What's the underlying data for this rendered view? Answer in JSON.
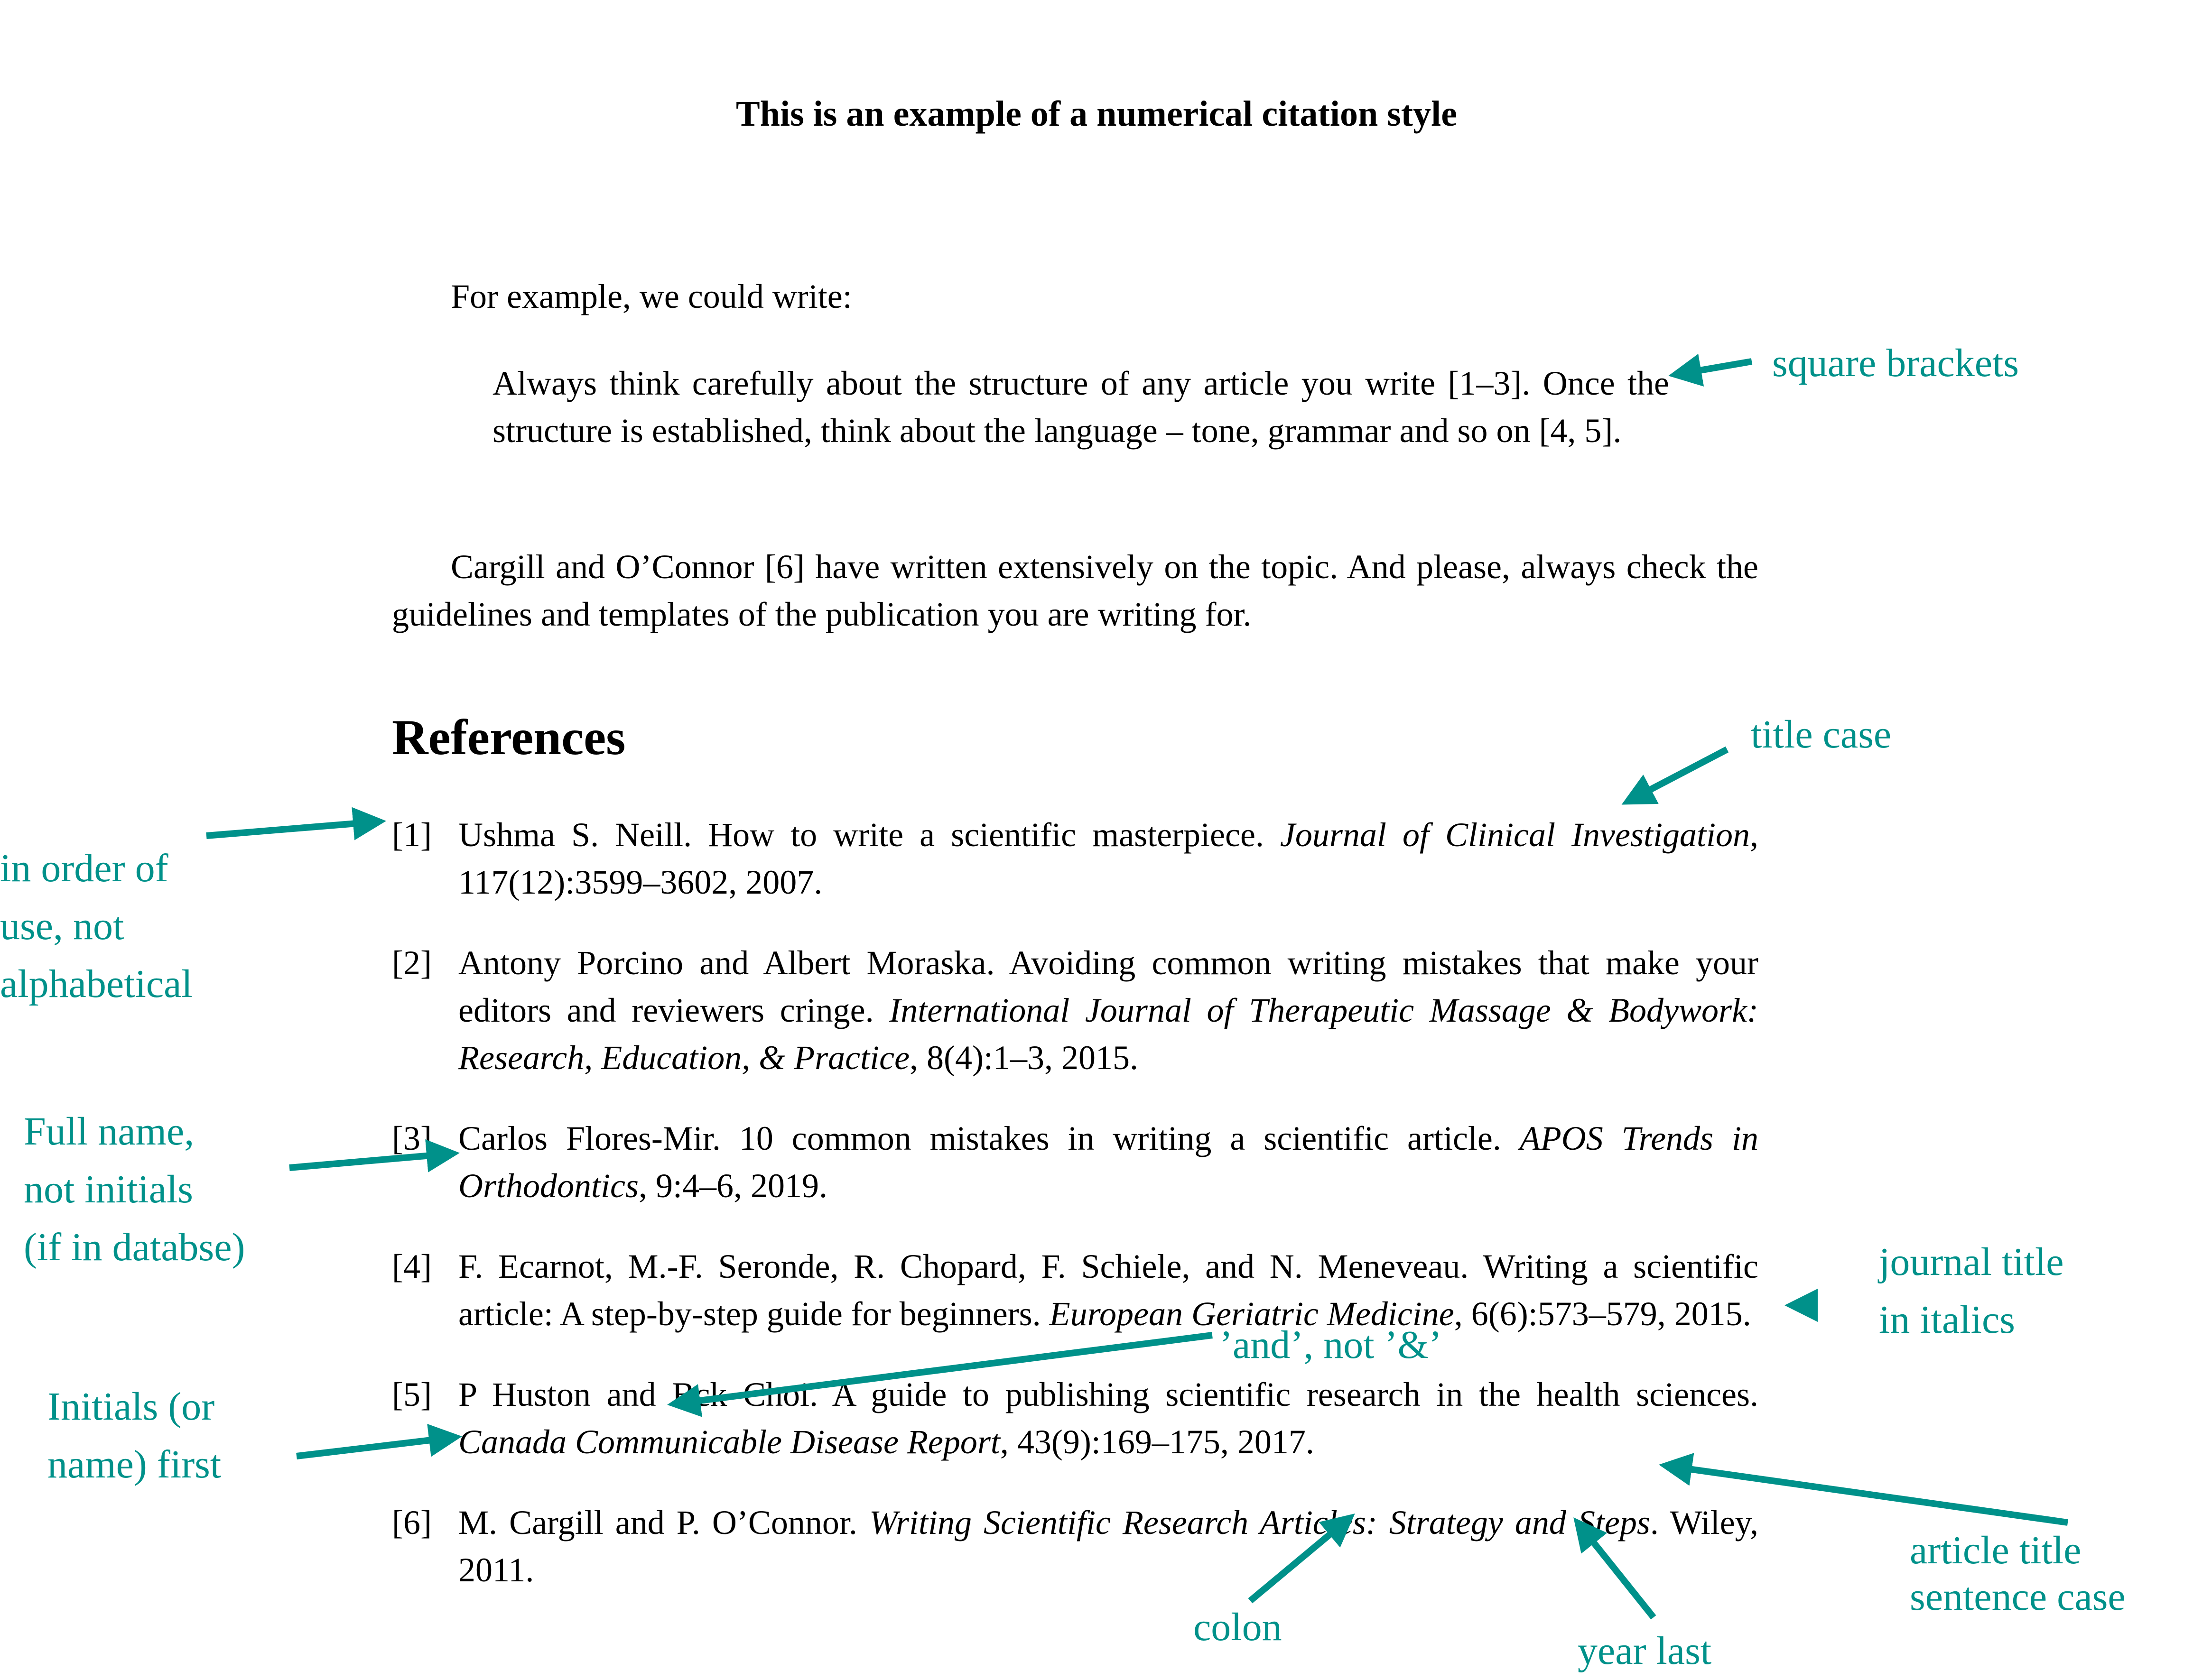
{
  "title": "This is an example of a numerical citation style",
  "intro": "For example, we could write:",
  "quote": "Always think carefully about the structure of any article you write [1–3]. Once the structure is established, think about the language – tone, grammar and so on [4, 5].",
  "paragraph": "Cargill and O’Connor [6] have written extensively on the topic. And please, always check the guidelines and templates of the publication you are writing for.",
  "references_heading": "References",
  "references": [
    {
      "num": "[1]",
      "pre": "Ushma S. Neill.  How to write a scientific masterpiece.  ",
      "italic": "Journal of Clinical Investigation",
      "post": ", 117(12):3599–3602, 2007."
    },
    {
      "num": "[2]",
      "pre": "Antony Porcino and Albert Moraska.  Avoiding common writing mistakes that make your editors and reviewers cringe. ",
      "italic": "International Journal of Therapeutic Massage & Bodywork: Research, Education, & Practice",
      "post": ", 8(4):1–3, 2015."
    },
    {
      "num": "[3]",
      "pre": "Carlos Flores-Mir.  10 common mistakes in writing a scientific article.  ",
      "italic": "APOS Trends in Orthodontics",
      "post": ", 9:4–6, 2019."
    },
    {
      "num": "[4]",
      "pre": "F. Ecarnot, M.-F. Seronde, R. Chopard, F. Schiele, and N. Meneveau. Writing a scientific article: A step-by-step guide for beginners.  ",
      "italic": "European Geriatric Medicine",
      "post": ", 6(6):573–579, 2015."
    },
    {
      "num": "[5]",
      "pre": "P Huston and Bck Choi.  A guide to publishing scientific research in the health sciences. ",
      "italic": "Canada Communicable Disease Report",
      "post": ", 43(9):169–175, 2017."
    },
    {
      "num": "[6]",
      "pre": "M. Cargill and P. O’Connor.  ",
      "italic": "Writing Scientific Research Articles:  Strategy and Steps",
      "post": ". Wiley, 2011."
    }
  ],
  "annotations": {
    "square_brackets": "square brackets",
    "title_case": "title case",
    "order_of_use": [
      "in order of",
      "use, not",
      "alphabetical"
    ],
    "full_name": [
      "Full name,",
      "not initials",
      "(if in databse)"
    ],
    "journal_italics": [
      "journal title",
      "in italics"
    ],
    "and_not_amp": "’and’, not ’&’",
    "initials_first": [
      "Initials (or",
      "name) first"
    ],
    "article_sentence_case": [
      "article title",
      "sentence case"
    ],
    "colon": "colon",
    "year_last": "year last"
  },
  "colors": {
    "annotation": "#00918A",
    "text": "#000000"
  }
}
